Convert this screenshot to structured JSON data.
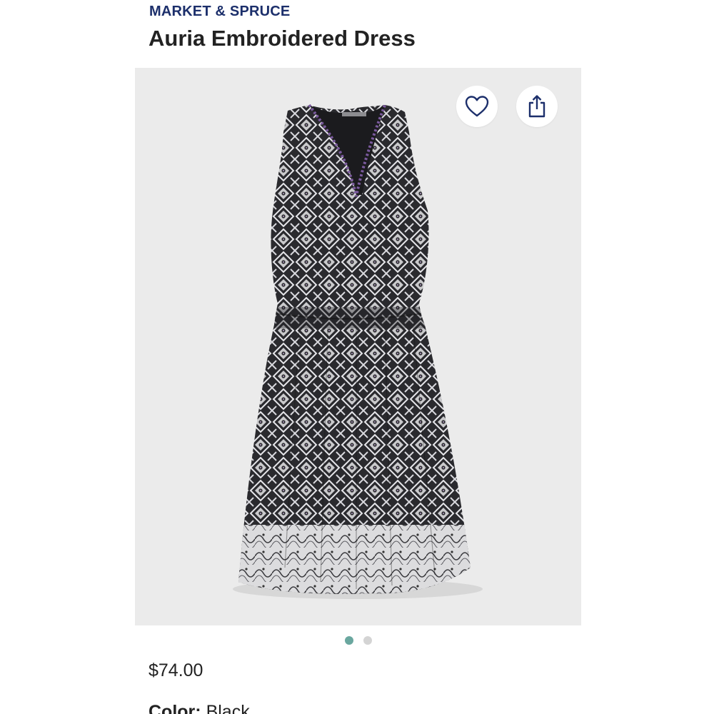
{
  "product": {
    "brand": "MARKET & SPRUCE",
    "title": "Auria Embroidered Dress",
    "price": "$74.00",
    "color_label": "Color:",
    "color_value": "Black"
  },
  "gallery": {
    "image_count": 2,
    "active_index": 0,
    "actions": {
      "favorite_icon": "heart-icon",
      "share_icon": "share-icon"
    }
  },
  "colors": {
    "brand": "#1c2f6b",
    "text": "#222222",
    "gallery_bg": "#ebebeb",
    "dot_active": "#6aa79f",
    "dot_inactive": "#d4d4d4"
  }
}
